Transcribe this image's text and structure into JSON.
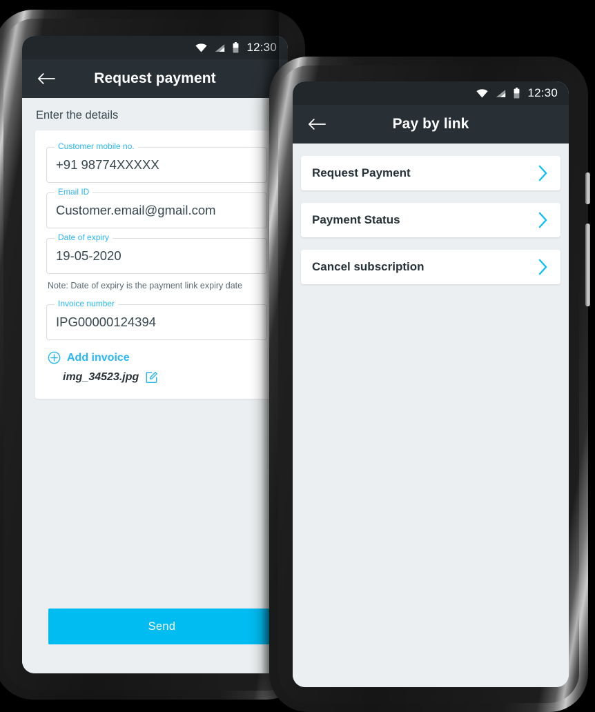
{
  "accent": {
    "cyan": "#29B6F6",
    "button_blue": "#00BCF0",
    "app_bar": "#293035",
    "status_bar": "#21272A",
    "screen_bg": "#ECEFF1"
  },
  "request_payment_screen": {
    "status_bar": {
      "time": "12:30",
      "icons": [
        "wifi-icon",
        "signal-icon",
        "battery-icon"
      ]
    },
    "app_bar": {
      "back": "back-arrow-icon",
      "title": "Request payment"
    },
    "section_title": "Enter the details",
    "fields": [
      {
        "label": "Customer mobile no.",
        "value": "+91 98774XXXXX"
      },
      {
        "label": "Email ID",
        "value": "Customer.email@gmail.com"
      },
      {
        "label": "Date of expiry",
        "value": "19-05-2020"
      },
      {
        "label": "Invoice number",
        "value": "IPG00000124394"
      }
    ],
    "expiry_note": "Note: Date of expiry is the payment link expiry date",
    "add_invoice": {
      "icon": "plus-circle-icon",
      "label": "Add invoice"
    },
    "attached_file": {
      "name": "img_34523.jpg",
      "edit_icon": "edit-square-icon"
    },
    "send_button": "Send"
  },
  "pay_by_link_screen": {
    "status_bar": {
      "time": "12:30",
      "icons": [
        "wifi-icon",
        "signal-icon",
        "battery-icon"
      ]
    },
    "app_bar": {
      "back": "back-arrow-icon",
      "title": "Pay by link"
    },
    "menu_items": [
      {
        "label": "Request Payment",
        "chevron": "chevron-right-icon"
      },
      {
        "label": "Payment Status",
        "chevron": "chevron-right-icon"
      },
      {
        "label": "Cancel subscription",
        "chevron": "chevron-right-icon"
      }
    ]
  }
}
